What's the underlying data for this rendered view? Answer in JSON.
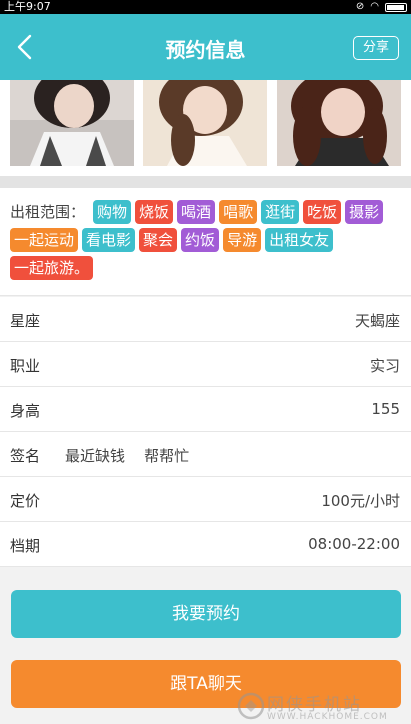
{
  "status_bar": {
    "time": "上午9:07"
  },
  "header": {
    "title": "预约信息",
    "share_label": "分享"
  },
  "scope": {
    "label": "出租范围：",
    "tags": [
      {
        "text": "购物",
        "color": "#3dbfcc"
      },
      {
        "text": "烧饭",
        "color": "#f0503c"
      },
      {
        "text": "喝酒",
        "color": "#a25cd6"
      },
      {
        "text": "唱歌",
        "color": "#f58a2e"
      },
      {
        "text": "逛街",
        "color": "#3dbfcc"
      },
      {
        "text": "吃饭",
        "color": "#f0503c"
      },
      {
        "text": "摄影",
        "color": "#a25cd6"
      },
      {
        "text": "一起运动",
        "color": "#f58a2e"
      },
      {
        "text": "看电影",
        "color": "#3dbfcc"
      },
      {
        "text": "聚会",
        "color": "#f0503c"
      },
      {
        "text": "约饭",
        "color": "#a25cd6"
      },
      {
        "text": "导游",
        "color": "#f58a2e"
      },
      {
        "text": "出租女友",
        "color": "#3dbfcc"
      },
      {
        "text": "一起旅游。",
        "color": "#f0503c"
      }
    ]
  },
  "info": {
    "zodiac": {
      "label": "星座",
      "value": "天蝎座"
    },
    "job": {
      "label": "职业",
      "value": "实习"
    },
    "height": {
      "label": "身高",
      "value": "155"
    },
    "signature": {
      "label": "签名",
      "value": "最近缺钱    帮帮忙"
    },
    "price": {
      "label": "定价",
      "value": "100元/小时"
    },
    "schedule": {
      "label": "档期",
      "value": "08:00-22:00"
    }
  },
  "buttons": {
    "book": "我要预约",
    "chat": "跟TA聊天"
  },
  "watermark": {
    "text": "网侠手机站",
    "sub": "WWW.HACKHOME.COM"
  },
  "colors": {
    "accent": "#3dbfcc",
    "orange": "#f58a2e",
    "red": "#f0503c",
    "purple": "#a25cd6"
  }
}
